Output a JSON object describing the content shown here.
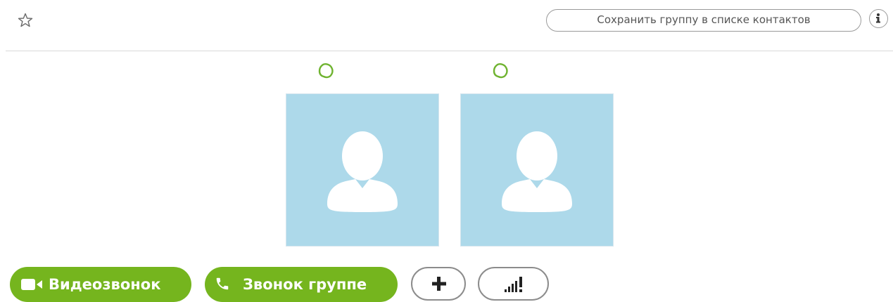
{
  "header": {
    "favorite_icon": "star-outline-icon",
    "save_group_label": "Сохранить группу в списке контактов",
    "info_icon": "info-icon"
  },
  "participants": [
    {
      "status_icon": "skype-status-icon",
      "avatar_icon": "default-user-avatar-icon"
    },
    {
      "status_icon": "skype-status-icon",
      "avatar_icon": "default-user-avatar-icon"
    }
  ],
  "actions": {
    "video_call_label": "Видеозвонок",
    "video_call_icon": "video-camera-icon",
    "group_call_label": "Звонок группе",
    "group_call_icon": "phone-icon",
    "add_icon": "plus-icon",
    "call_quality_icon": "signal-bars-icon"
  },
  "colors": {
    "accent_green": "#75b51e",
    "status_green": "#6fb330",
    "avatar_bg": "#add9ea",
    "border_gray": "#9a9a9a"
  }
}
